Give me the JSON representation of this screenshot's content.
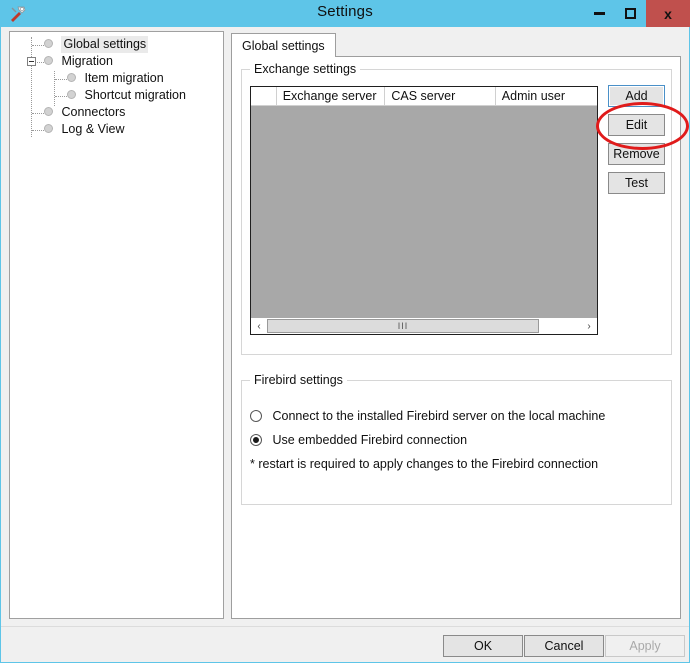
{
  "window": {
    "title": "Settings",
    "icon": "tools-icon",
    "minimize_label": "Minimize",
    "maximize_label": "Maximize",
    "close_label": "x",
    "titlebar_color": "#5ec5e8",
    "close_color": "#c0504d"
  },
  "sidebar": {
    "items": [
      {
        "label": "Global settings",
        "level": 0,
        "selected": true
      },
      {
        "label": "Migration",
        "level": 0,
        "selected": false,
        "expander": "minus"
      },
      {
        "label": "Item migration",
        "level": 1,
        "selected": false
      },
      {
        "label": "Shortcut migration",
        "level": 1,
        "selected": false
      },
      {
        "label": "Connectors",
        "level": 0,
        "selected": false
      },
      {
        "label": "Log & View",
        "level": 0,
        "selected": false
      }
    ]
  },
  "tabs": [
    {
      "label": "Global settings",
      "active": true
    }
  ],
  "exchange_settings": {
    "group_title": "Exchange settings",
    "columns": [
      "",
      "Exchange server",
      "CAS server",
      "Admin user"
    ],
    "rows": [],
    "scrollbar": {
      "left_arrow": "‹",
      "right_arrow": "›",
      "thumb_grip": "III"
    },
    "buttons": [
      {
        "label": "Add",
        "focused": true,
        "annotated": true
      },
      {
        "label": "Edit",
        "focused": false,
        "annotated": false
      },
      {
        "label": "Remove",
        "focused": false,
        "annotated": false
      },
      {
        "label": "Test",
        "focused": false,
        "annotated": false
      }
    ]
  },
  "firebird_settings": {
    "group_title": "Firebird settings",
    "options": [
      {
        "label": "Connect to the installed Firebird server on the local machine",
        "selected": false
      },
      {
        "label": "Use embedded Firebird connection",
        "selected": true
      }
    ],
    "note": "* restart is required to apply changes to the Firebird connection"
  },
  "footer": {
    "ok_label": "OK",
    "cancel_label": "Cancel",
    "apply_label": "Apply",
    "apply_disabled": true
  },
  "annotation": {
    "color": "#e01b1b",
    "target": "Add"
  }
}
